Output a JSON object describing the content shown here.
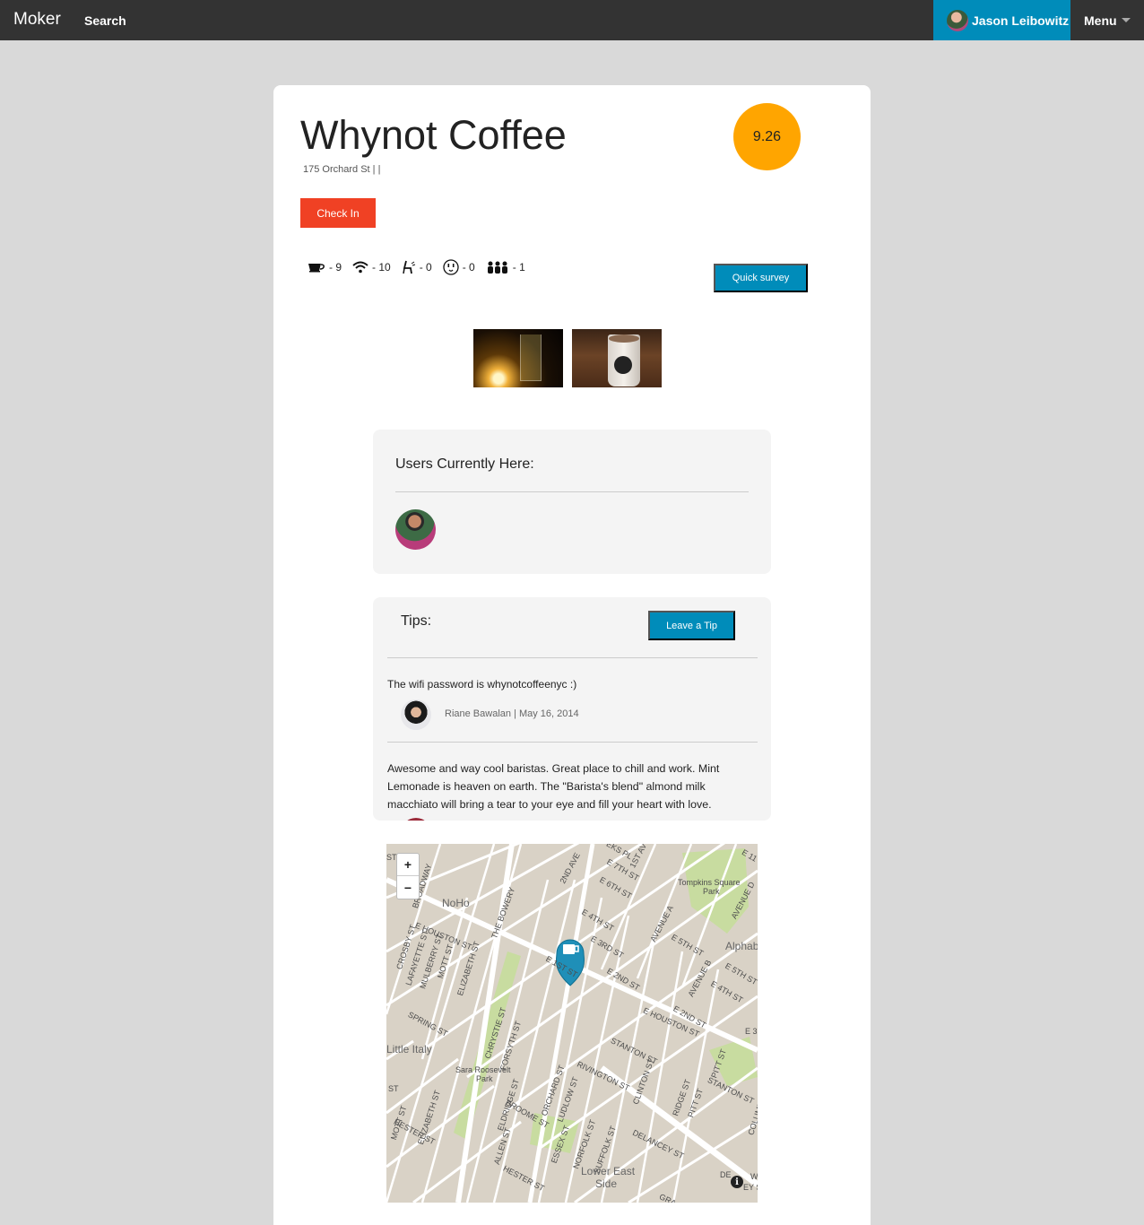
{
  "nav": {
    "brand": "Moker",
    "search": "Search",
    "user_name": "Jason Leibowitz",
    "menu": "Menu"
  },
  "venue": {
    "name": "Whynot Coffee",
    "address": "175 Orchard St | |",
    "score": "9.26",
    "check_in": "Check In",
    "quick_survey": "Quick survey"
  },
  "amenities": [
    {
      "icon": "coffee-cup-icon",
      "label": "- 9"
    },
    {
      "icon": "wifi-icon",
      "label": "- 10"
    },
    {
      "icon": "seating-icon",
      "label": "- 0"
    },
    {
      "icon": "power-outlet-icon",
      "label": "- 0"
    },
    {
      "icon": "crowd-icon",
      "label": "- 1"
    }
  ],
  "users_here": {
    "heading": "Users Currently Here:"
  },
  "tips": {
    "heading": "Tips:",
    "leave_tip": "Leave a Tip",
    "items": [
      {
        "text": "The wifi password is whynotcoffeenyc :)",
        "author": "Riane Bawalan",
        "date": "May 16, 2014",
        "meta": "Riane Bawalan | May 16, 2014"
      },
      {
        "text": "Awesome and way cool baristas. Great place to chill and work. Mint Lemonade is heaven on earth. The \"Barista's blend\" almond milk macchiato will bring a tear to your eye and fill your heart with love."
      }
    ]
  },
  "map": {
    "zoom_in": "+",
    "zoom_out": "−",
    "info": "i",
    "labels": {
      "noho": "NoHo",
      "tompkins": "Tompkins Square",
      "tompkins2": "Park",
      "alphabet": "Alphab",
      "little_italy": "Little Italy",
      "sara": "Sara Roosevelt",
      "sara2": "Park",
      "lower_east": "Lower East",
      "lower_east2": "Side",
      "e_houston": "E HOUSTON ST",
      "e_houston2": "E HOUSTON ST",
      "bowery": "THE BOWERY",
      "second_ave": "2ND AVE",
      "first_ave": "1ST AV",
      "avenue_a": "AVENUE A",
      "avenue_b": "AVENUE B",
      "avenue_d": "AVENUE D",
      "e_7th": "E 7TH ST",
      "e_6th": "E 6TH ST",
      "e_5th": "E 5TH ST",
      "e_4th": "E 4TH ST",
      "e_3rd": "E 3RD ST",
      "e_2nd": "E 2ND ST",
      "e_2nd_b": "E 2ND ST",
      "e_1st": "E 1ST ST",
      "e_5th_b": "E 5TH ST",
      "e_4th_b": "E 4TH ST",
      "stanton": "STANTON ST",
      "stanton2": "STANTON ST",
      "rivington": "RIVINGTON ST",
      "delancey": "DELANCEY ST",
      "hester": "HESTER ST",
      "hester2": "HESTER ST",
      "spring": "SPRING ST",
      "chrystie": "CHRYSTIE ST",
      "forsyth": "FORSYTH ST",
      "eldridge": "ELDRIDGE ST",
      "allen": "ALLEN ST",
      "orchard": "ORCHARD ST",
      "ludlow": "LUDLOW ST",
      "essex": "ESSEX ST",
      "norfolk": "NORFOLK ST",
      "suffolk": "SUFFOLK ST",
      "clinton": "CLINTON ST",
      "ridge": "RIDGE ST",
      "pitt": "PITT ST",
      "pitt2": "PITT ST",
      "broome": "BROOME ST",
      "elizabeth": "ELIZABETH ST",
      "elizabeth2": "ELIZABETH ST",
      "mott": "MOTT ST",
      "mott2": "MOTT ST",
      "mulberry": "MULBERRY ST",
      "lafayette": "LAFAYETTE ST",
      "crosby": "CROSBY ST",
      "broadway": "BROADWAY",
      "grand": "GRA",
      "columbia": "COLUMBI",
      "e_st": "E 3",
      "street_st": "ST",
      "st_left": "ST",
      "eks_pl": "EKS PL",
      "e11": "E 11",
      "w": "W",
      "de": "DE",
      "ey": "EY S"
    }
  },
  "colors": {
    "topbar": "#333333",
    "accent": "#008cba",
    "alert": "#f04124",
    "score": "#ffa500",
    "background": "#d9d9d9"
  }
}
